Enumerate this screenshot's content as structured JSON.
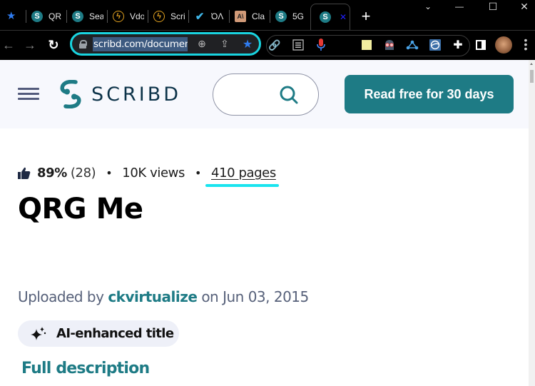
{
  "browser": {
    "tabs": [
      {
        "title": "QR",
        "icon": "scribd-favicon-icon"
      },
      {
        "title": "Sea",
        "icon": "scribd-favicon-icon"
      },
      {
        "title": "Vdo",
        "icon": "vdo-lightning-icon"
      },
      {
        "title": "Scri",
        "icon": "vdo-lightning-icon"
      },
      {
        "title": "ΌΛ",
        "icon": "checkmark-favicon-icon"
      },
      {
        "title": "Cla",
        "icon": "anthropic-favicon-icon"
      },
      {
        "title": "5G",
        "icon": "scribd-favicon-icon"
      },
      {
        "title": "",
        "icon": "scribd-favicon-icon",
        "active": true
      }
    ],
    "tab_close_glyph": "✕",
    "new_tab_glyph": "+",
    "window_controls": {
      "tab_search": "⌄",
      "minimize": "—",
      "maximize": "☐",
      "close": "✕"
    },
    "url": "scribd.com/document",
    "toolbar_icons": [
      "back-icon",
      "forward-icon",
      "reload-icon",
      "lock-icon",
      "zoom-icon",
      "share-icon",
      "bookmark-star-icon"
    ],
    "extensions": [
      "link-extension-icon",
      "reader-extension-icon",
      "microphone-extension-icon",
      "sticky-note-extension-icon",
      "robot-extension-icon",
      "share-nodes-extension-icon",
      "browser-extension-icon",
      "puzzle-extensions-icon",
      "side-panel-icon"
    ],
    "accent_color": "#19d4e0"
  },
  "site": {
    "brand": "SCRIBD",
    "search_placeholder": "",
    "cta_label": "Read free for 30 days",
    "brand_color": "#1e7b85"
  },
  "document": {
    "rating_percent": "89%",
    "rating_count": "(28)",
    "views": "10K views",
    "pages": "410 pages",
    "separator": "•",
    "title": "QRG Me",
    "uploaded_prefix": "Uploaded by",
    "uploader": "ckvirtualize",
    "uploaded_suffix": "on Jun 03, 2015",
    "ai_chip_label": "AI-enhanced title",
    "full_description_label": "Full description"
  }
}
